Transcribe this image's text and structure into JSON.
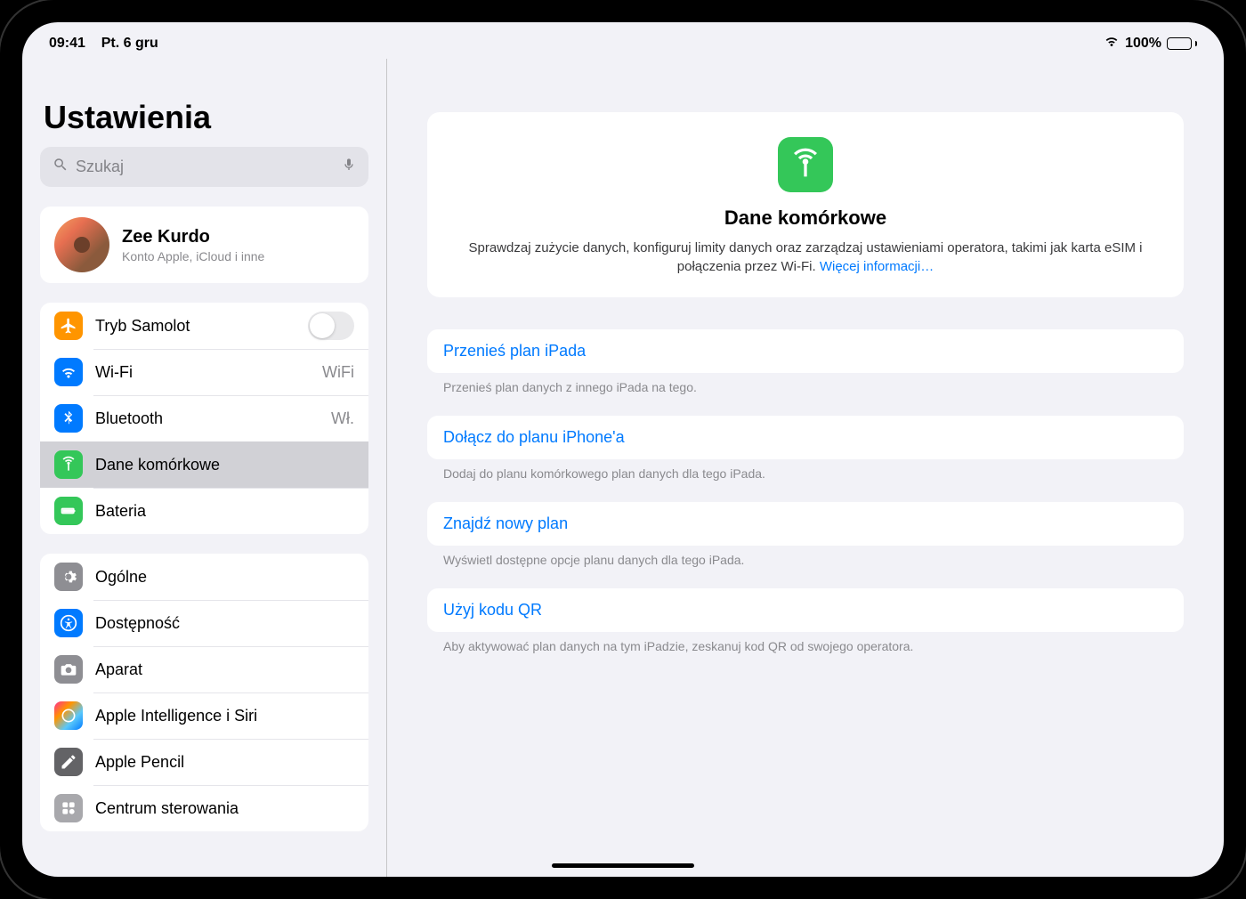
{
  "statusbar": {
    "time": "09:41",
    "date": "Pt. 6 gru",
    "battery_pct": "100%"
  },
  "sidebar": {
    "title": "Ustawienia",
    "search_placeholder": "Szukaj",
    "account": {
      "name": "Zee Kurdo",
      "subtitle": "Konto Apple, iCloud i inne"
    },
    "group1": [
      {
        "label": "Tryb Samolot",
        "icon": "airplane",
        "color": "orange",
        "type": "toggle"
      },
      {
        "label": "Wi-Fi",
        "icon": "wifi",
        "color": "blue",
        "value": "WiFi"
      },
      {
        "label": "Bluetooth",
        "icon": "bluetooth",
        "color": "blue",
        "value": "Wł."
      },
      {
        "label": "Dane komórkowe",
        "icon": "cellular",
        "color": "green",
        "selected": true
      },
      {
        "label": "Bateria",
        "icon": "battery",
        "color": "green"
      }
    ],
    "group2": [
      {
        "label": "Ogólne",
        "icon": "gear",
        "color": "gray"
      },
      {
        "label": "Dostępność",
        "icon": "accessibility",
        "color": "blue"
      },
      {
        "label": "Aparat",
        "icon": "camera",
        "color": "gray"
      },
      {
        "label": "Apple Intelligence i Siri",
        "icon": "siri",
        "color": "gradient"
      },
      {
        "label": "Apple Pencil",
        "icon": "pencil",
        "color": "darkgray"
      },
      {
        "label": "Centrum sterowania",
        "icon": "controlcenter",
        "color": "lightgray"
      }
    ]
  },
  "detail": {
    "hero_title": "Dane komórkowe",
    "hero_desc": "Sprawdzaj zużycie danych, konfiguruj limity danych oraz zarządzaj ustawieniami operatora, takimi jak karta eSIM i połączenia przez Wi-Fi. ",
    "hero_link": "Więcej informacji…",
    "options": [
      {
        "title": "Przenieś plan iPada",
        "desc": "Przenieś plan danych z innego iPada na tego."
      },
      {
        "title": "Dołącz do planu iPhone'a",
        "desc": "Dodaj do planu komórkowego plan danych dla tego iPada."
      },
      {
        "title": "Znajdź nowy plan",
        "desc": "Wyświetl dostępne opcje planu danych dla tego iPada."
      },
      {
        "title": "Użyj kodu QR",
        "desc": "Aby aktywować plan danych na tym iPadzie, zeskanuj kod QR od swojego operatora."
      }
    ]
  }
}
